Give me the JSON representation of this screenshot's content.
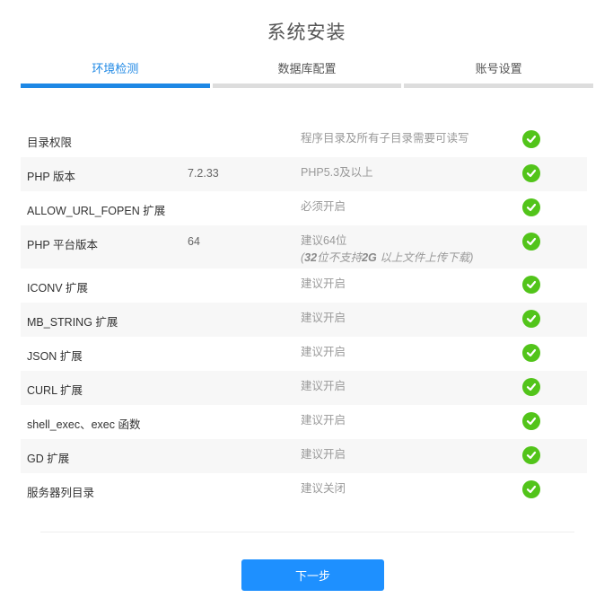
{
  "page": {
    "title": "系统安装"
  },
  "steps": [
    {
      "label": "环境检测",
      "active": true
    },
    {
      "label": "数据库配置",
      "active": false
    },
    {
      "label": "账号设置",
      "active": false
    }
  ],
  "checks": [
    {
      "name": "目录权限",
      "value": "",
      "desc": "程序目录及所有子目录需要可读写",
      "status": "ok"
    },
    {
      "name": "PHP 版本",
      "value": "7.2.33",
      "desc": "PHP5.3及以上",
      "status": "ok"
    },
    {
      "name": "ALLOW_URL_FOPEN 扩展",
      "value": "",
      "desc": "必须开启",
      "status": "ok"
    },
    {
      "name": "PHP 平台版本",
      "value": "64",
      "desc": "建议64位",
      "note_pre": "(",
      "note_b1": "32",
      "note_mid1": "位不支持",
      "note_b2": "2G",
      "note_mid2": " 以上文件上传下载",
      "note_post": ")",
      "status": "ok"
    },
    {
      "name": "ICONV 扩展",
      "value": "",
      "desc": "建议开启",
      "status": "ok"
    },
    {
      "name": "MB_STRING 扩展",
      "value": "",
      "desc": "建议开启",
      "status": "ok"
    },
    {
      "name": "JSON 扩展",
      "value": "",
      "desc": "建议开启",
      "status": "ok"
    },
    {
      "name": "CURL 扩展",
      "value": "",
      "desc": "建议开启",
      "status": "ok"
    },
    {
      "name": "shell_exec、exec 函数",
      "value": "",
      "desc": "建议开启",
      "status": "ok"
    },
    {
      "name": "GD 扩展",
      "value": "",
      "desc": "建议开启",
      "status": "ok"
    },
    {
      "name": "服务器列目录",
      "value": "",
      "desc": "建议关闭",
      "status": "ok"
    }
  ],
  "actions": {
    "next_label": "下一步"
  },
  "colors": {
    "accent": "#1e88e5",
    "ok": "#52c41a",
    "button": "#1e90ff"
  },
  "icons": {
    "status_ok": "check-circle-icon"
  }
}
